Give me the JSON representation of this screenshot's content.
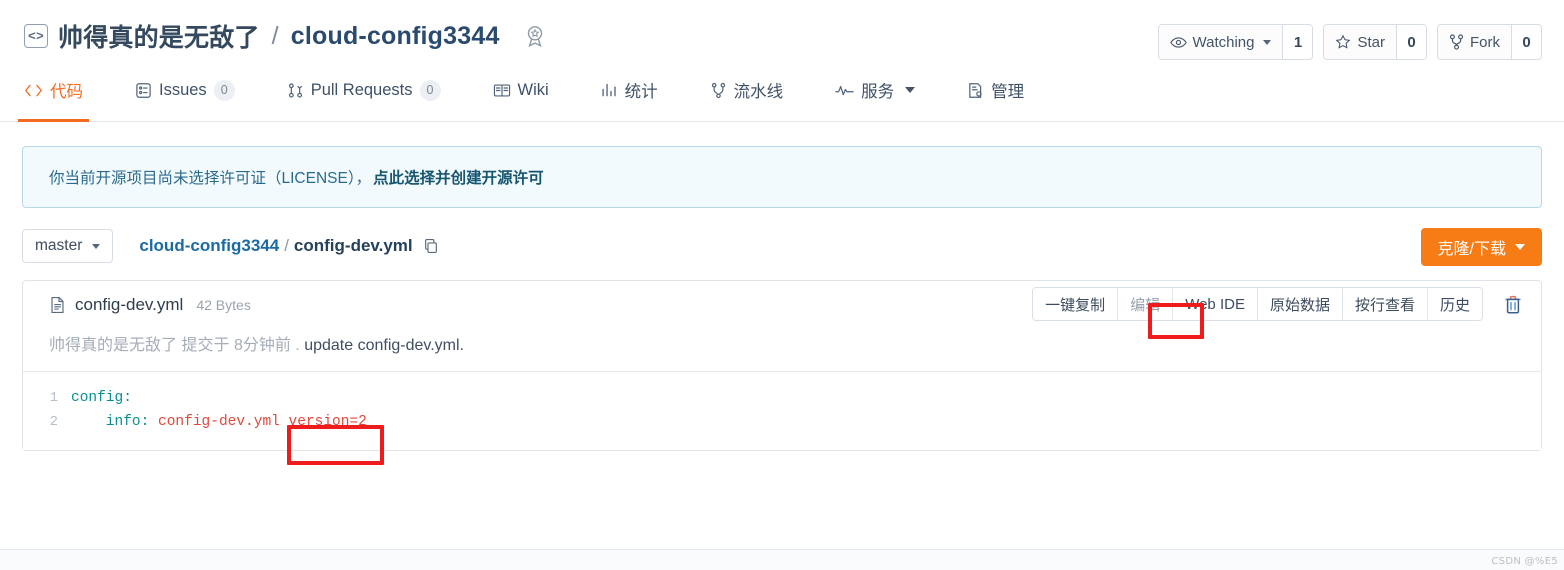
{
  "header": {
    "repo_icon": "code-brackets-icon",
    "owner": "帅得真的是无敌了",
    "separator": "/",
    "repo": "cloud-config3344",
    "medal_icon": "medal-badge-icon",
    "actions": [
      {
        "icon": "eye-icon",
        "label": "Watching",
        "has_caret": true,
        "count": "1"
      },
      {
        "icon": "star-icon",
        "label": "Star",
        "has_caret": false,
        "count": "0"
      },
      {
        "icon": "fork-icon",
        "label": "Fork",
        "has_caret": false,
        "count": "0"
      }
    ]
  },
  "nav": {
    "tabs": [
      {
        "label": "代码",
        "icon": "code-icon",
        "active": true,
        "count": null,
        "caret": false
      },
      {
        "label": "Issues",
        "icon": "issues-icon",
        "active": false,
        "count": "0",
        "caret": false
      },
      {
        "label": "Pull Requests",
        "icon": "pull-request-icon",
        "active": false,
        "count": "0",
        "caret": false
      },
      {
        "label": "Wiki",
        "icon": "wiki-book-icon",
        "active": false,
        "count": null,
        "caret": false
      },
      {
        "label": "统计",
        "icon": "chart-stats-icon",
        "active": false,
        "count": null,
        "caret": false
      },
      {
        "label": "流水线",
        "icon": "pipeline-icon",
        "active": false,
        "count": null,
        "caret": false
      },
      {
        "label": "服务",
        "icon": "pulse-icon",
        "active": false,
        "count": null,
        "caret": true
      },
      {
        "label": "管理",
        "icon": "settings-doc-icon",
        "active": false,
        "count": null,
        "caret": false
      }
    ]
  },
  "license_alert": {
    "text": "你当前开源项目尚未选择许可证（LICENSE），",
    "link": "点此选择并创建开源许可"
  },
  "breadcrumb": {
    "branch_label": "master",
    "repo_link": "cloud-config3344",
    "separator": "/",
    "current_file": "config-dev.yml",
    "copy_icon": "copy-path-icon",
    "clone_button": "克隆/下载"
  },
  "file": {
    "file_icon": "file-text-icon",
    "name": "config-dev.yml",
    "size": "42 Bytes",
    "tools": [
      {
        "label": "一键复制",
        "muted": false,
        "highlighted": false
      },
      {
        "label": "编辑",
        "muted": true,
        "highlighted": true
      },
      {
        "label": "Web IDE",
        "muted": false,
        "highlighted": false
      },
      {
        "label": "原始数据",
        "muted": false,
        "highlighted": false
      },
      {
        "label": "按行查看",
        "muted": false,
        "highlighted": false
      },
      {
        "label": "历史",
        "muted": false,
        "highlighted": false
      }
    ],
    "delete_icon": "trash-icon",
    "commit": {
      "author": "帅得真的是无敌了",
      "action": "提交于",
      "time": "8分钟前",
      "dot": ".",
      "message": "update config-dev.yml."
    },
    "code": {
      "lines": [
        {
          "num": "1",
          "key": "config:",
          "value": ""
        },
        {
          "num": "2",
          "key": "    info:",
          "value": " config-dev.yml version=2"
        }
      ]
    }
  },
  "annotations": [
    {
      "name": "edit-button-highlight"
    },
    {
      "name": "version-value-highlight"
    }
  ],
  "watermark": "CSDN @%E5",
  "colors": {
    "accent_orange": "#f26b21",
    "clone_orange": "#f77c15",
    "annotation_red": "#ee1c1c",
    "link_blue": "#1b6ba3",
    "code_key_teal": "#0a8f8f",
    "code_string_red": "#e2483a"
  }
}
